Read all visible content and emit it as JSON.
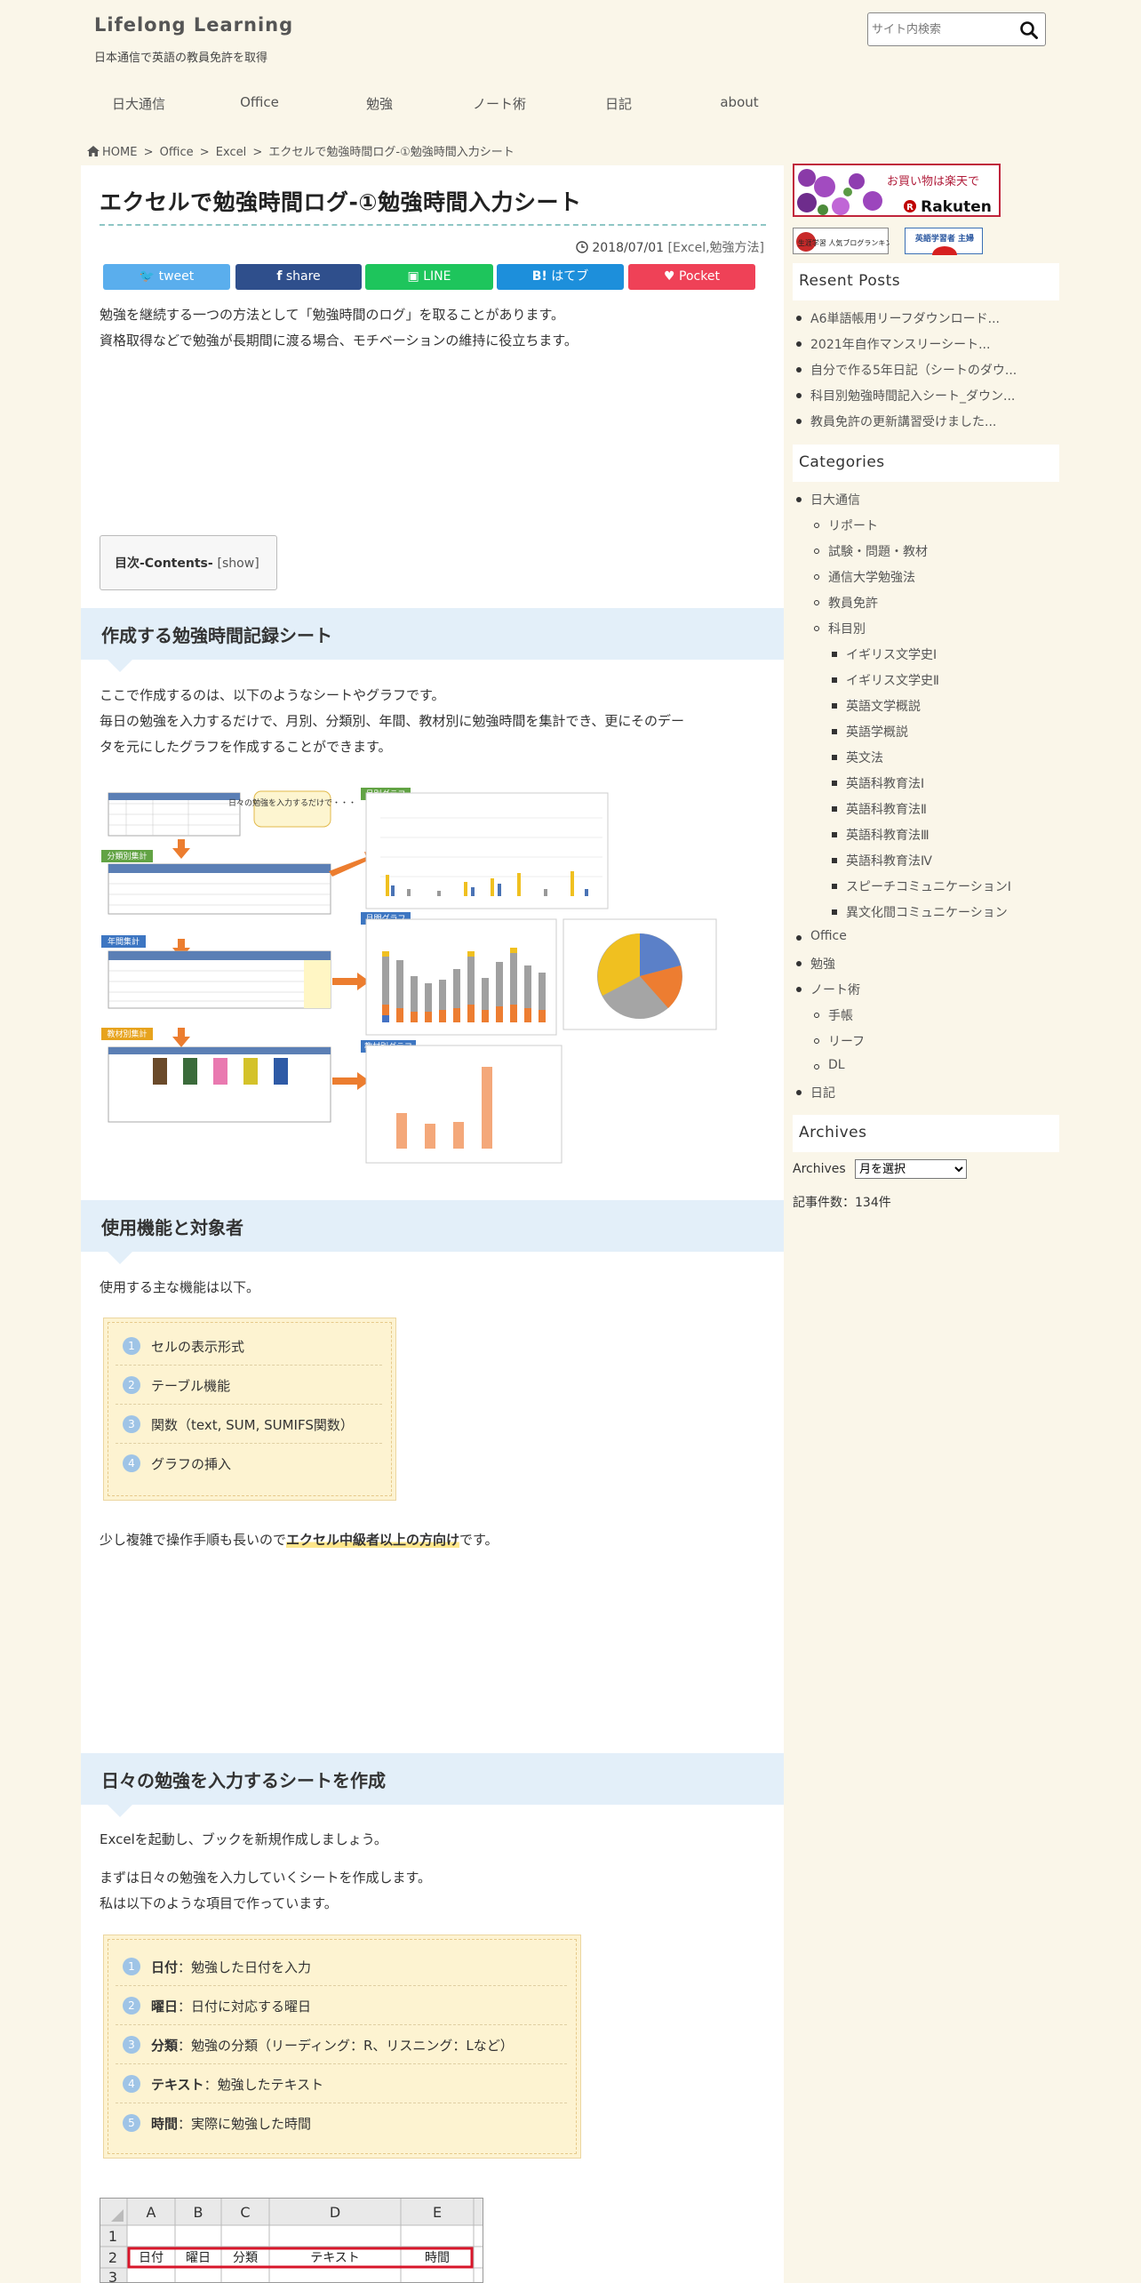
{
  "site": {
    "title": "Lifelong Learning",
    "description": "日本通信で英語の教員免許を取得",
    "search_placeholder": "サイト内検索"
  },
  "nav": [
    "日大通信",
    "Office",
    "勉強",
    "ノート術",
    "日記",
    "about"
  ],
  "breadcrumb": [
    "HOME",
    ">",
    "Office",
    ">",
    "Excel",
    ">",
    "エクセルで勉強時間ログ-①勉強時間入力シート"
  ],
  "post": {
    "title": "エクセルで勉強時間ログ-①勉強時間入力シート",
    "date": "2018/07/01",
    "categories": "[Excel,勉強方法]",
    "share": {
      "tweet": "tweet",
      "facebook": "share",
      "line": "LINE",
      "hatena": "はてブ",
      "pocket": "Pocket"
    },
    "intro1": "勉強を継続する一つの方法として「勉強時間のログ」を取ることがあります。",
    "intro2": "資格取得などで勉強が長期間に渡る場合、モチベーションの維持に役立ちます。",
    "toc_label": "目次-Contents-",
    "toc_show": "[show]",
    "section1": {
      "heading": "作成する勉強時間記録シート",
      "p1": "ここで作成するのは、以下のようなシートやグラフです。",
      "p2": "毎日の勉強を入力するだけで、月別、分類別、年間、教材別に勉強時間を集計でき、更にそのデー",
      "p3": "タを元にしたグラフを作成することができます。"
    },
    "figure": {
      "bubble": "日々の勉強を入力するだけで・・・",
      "labels": [
        "分類別集計",
        "月別グラフ",
        "年間集計",
        "月間グラフ",
        "教材別集計",
        "教材別グラフ"
      ]
    },
    "section2": {
      "heading": "使用機能と対象者",
      "p1": "使用する主な機能は以下。",
      "features": [
        "セルの表示形式",
        "テーブル機能",
        "関数（text, SUM, SUMIFS関数）",
        "グラフの挿入"
      ],
      "note_pre": "少し複雑で操作手順も長いので",
      "note_bold": "エクセル中級者以上の方向け",
      "note_post": "です。"
    },
    "section3": {
      "heading": "日々の勉強を入力するシートを作成",
      "p1": "Excelを起動し、ブックを新規作成しましょう。",
      "p2": "まずは日々の勉強を入力していくシートを作成します。",
      "p3": "私は以下のような項目で作っています。",
      "items": [
        {
          "term": "日付",
          "desc": "：勉強した日付を入力"
        },
        {
          "term": "曜日",
          "desc": "：日付に対応する曜日"
        },
        {
          "term": "分類",
          "desc": "：勉強の分類（リーディング：R、リスニング：Lなど）"
        },
        {
          "term": "テキスト",
          "desc": "：勉強したテキスト"
        },
        {
          "term": "時間",
          "desc": "：実際に勉強した時間"
        }
      ]
    },
    "excel": {
      "cols": [
        "A",
        "B",
        "C",
        "D",
        "E"
      ],
      "rows": [
        "1",
        "2",
        "3"
      ],
      "headers": [
        "日付",
        "曜日",
        "分類",
        "テキスト",
        "時間"
      ]
    }
  },
  "sidebar": {
    "banner1_text": "お買い物は楽天で",
    "banner1_brand": "Rakuten",
    "banner2_text": "生涯学習 人気ブログランキング",
    "banner3_text": "英語学習者 主婦",
    "recent_heading": "Resent Posts",
    "recent": [
      "A6単語帳用リーフダウンロード...",
      "2021年自作マンスリーシート...",
      "自分で作る5年日記（シートのダウ...",
      "科目別勉強時間記入シート_ダウン...",
      "教員免許の更新講習受けました..."
    ],
    "categories_heading": "Categories",
    "categories": [
      {
        "label": "日大通信",
        "level": 0
      },
      {
        "label": "リポート",
        "level": 1
      },
      {
        "label": "試験・問題・教材",
        "level": 1
      },
      {
        "label": "通信大学勉強法",
        "level": 1
      },
      {
        "label": "教員免許",
        "level": 1
      },
      {
        "label": "科目別",
        "level": 1
      },
      {
        "label": "イギリス文学史Ⅰ",
        "level": 2
      },
      {
        "label": "イギリス文学史Ⅱ",
        "level": 2
      },
      {
        "label": "英語文学概説",
        "level": 2
      },
      {
        "label": "英語学概説",
        "level": 2
      },
      {
        "label": "英文法",
        "level": 2
      },
      {
        "label": "英語科教育法Ⅰ",
        "level": 2
      },
      {
        "label": "英語科教育法Ⅱ",
        "level": 2
      },
      {
        "label": "英語科教育法Ⅲ",
        "level": 2
      },
      {
        "label": "英語科教育法Ⅳ",
        "level": 2
      },
      {
        "label": "スピーチコミュニケーションⅠ",
        "level": 2
      },
      {
        "label": "異文化間コミュニケーション",
        "level": 2
      },
      {
        "label": "Office",
        "level": 0
      },
      {
        "label": "勉強",
        "level": 0
      },
      {
        "label": "ノート術",
        "level": 0
      },
      {
        "label": "手帳",
        "level": 1
      },
      {
        "label": "リーフ",
        "level": 1
      },
      {
        "label": "DL",
        "level": 1
      },
      {
        "label": "日記",
        "level": 0
      }
    ],
    "archives_heading": "Archives",
    "archives_label": "Archives",
    "archives_select": "月を選択",
    "count": "記事件数：134件"
  },
  "colors": {
    "background": "#faf6e9",
    "h2_bar": "#e3eff9",
    "list_box": "#fdf3d1",
    "twitter": "#5aaeed",
    "facebook": "#2f4f8c",
    "line": "#1ec55c",
    "hatena": "#1d8fdb",
    "pocket": "#ef4157"
  }
}
